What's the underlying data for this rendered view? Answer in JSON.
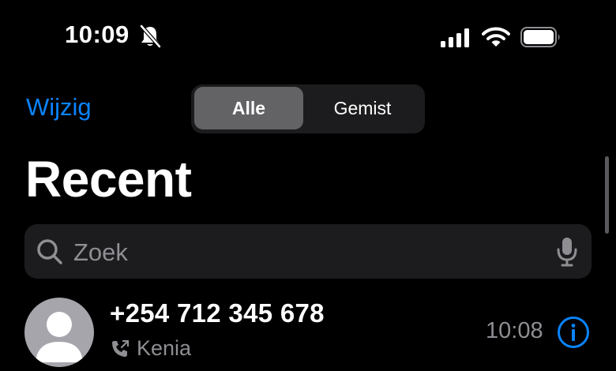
{
  "status_bar": {
    "time": "10:09",
    "silent_icon": "bell-slash-icon",
    "signal_icon": "cellular-signal-icon",
    "wifi_icon": "wifi-icon",
    "battery_icon": "battery-icon"
  },
  "nav": {
    "edit_label": "Wijzig",
    "segments": [
      {
        "label": "Alle",
        "selected": true
      },
      {
        "label": "Gemist",
        "selected": false
      }
    ]
  },
  "page_title": "Recent",
  "search": {
    "placeholder": "Zoek",
    "value": "",
    "icon": "magnifying-glass-icon",
    "mic_icon": "microphone-icon"
  },
  "calls": [
    {
      "number": "+254 712 345 678",
      "label": "Kenia",
      "label_icon": "phone-outgoing-icon",
      "time": "10:08",
      "info_icon": "info-icon"
    }
  ],
  "colors": {
    "accent": "#0a84ff",
    "background": "#000000",
    "secondary_text": "#8e8e93",
    "field_background": "#1c1c1e"
  }
}
